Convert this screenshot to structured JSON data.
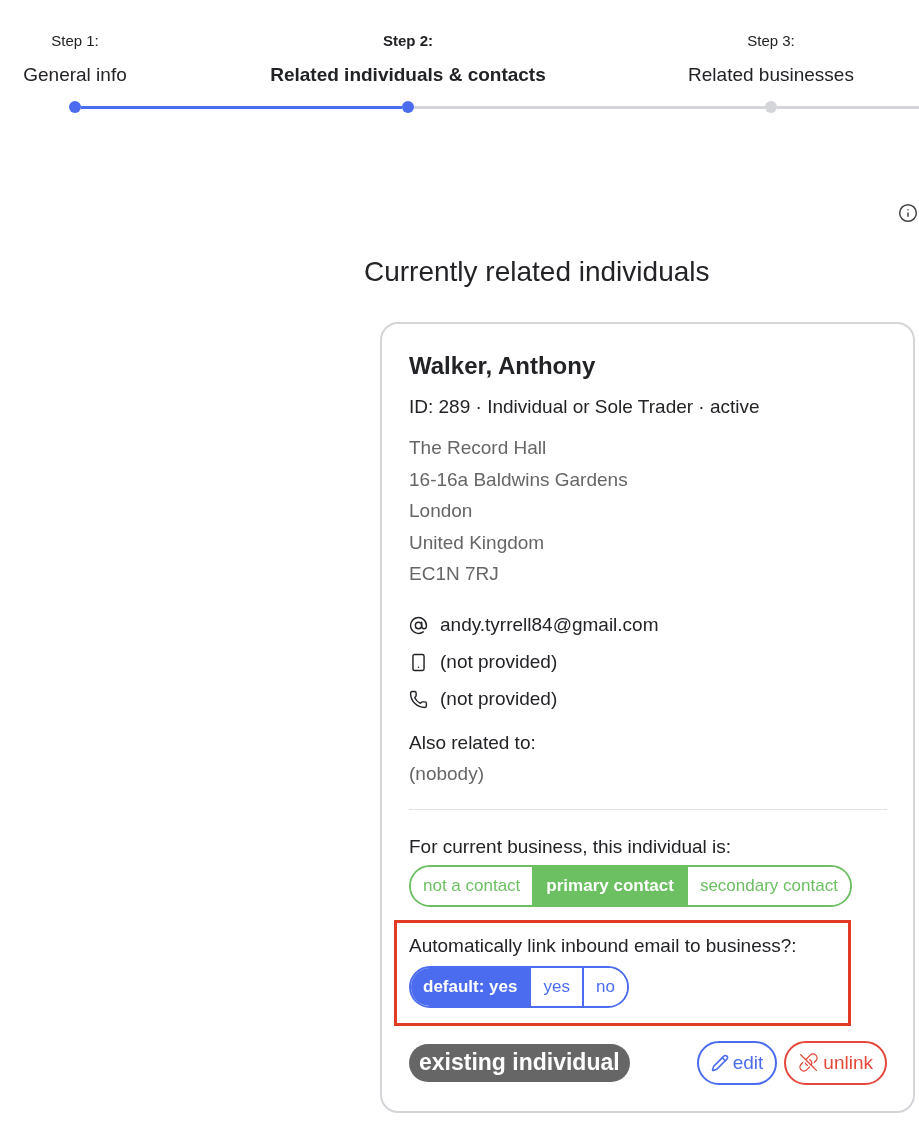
{
  "steps": [
    {
      "step": "Step 1:",
      "label": "General info",
      "completed": true,
      "current": false
    },
    {
      "step": "Step 2:",
      "label": "Related individuals & contacts",
      "completed": false,
      "current": true
    },
    {
      "step": "Step 3:",
      "label": "Related businesses",
      "completed": false,
      "current": false
    }
  ],
  "section_title": "Currently related individuals",
  "individual_card": {
    "name": "Walker, Anthony",
    "summary": "ID: 289 · Individual or Sole Trader · active",
    "address": [
      "The Record Hall",
      "16-16a Baldwins Gardens",
      "London",
      "United Kingdom",
      "EC1N 7RJ"
    ],
    "contacts": [
      {
        "kind": "email",
        "value": "andy.tyrrell84@gmail.com"
      },
      {
        "kind": "mobile",
        "value": "(not provided)"
      },
      {
        "kind": "phone",
        "value": "(not provided)"
      }
    ],
    "also_related_label": "Also related to:",
    "also_related_value": "(nobody)",
    "contact_role": {
      "label": "For current business, this individual is:",
      "options": [
        {
          "label": "not a contact",
          "selected": false
        },
        {
          "label": "primary contact",
          "selected": true
        },
        {
          "label": "secondary contact",
          "selected": false
        }
      ]
    },
    "email_link": {
      "label": "Automatically link inbound email to business?:",
      "highlighted": true,
      "options": [
        {
          "label": "default: yes",
          "selected": true
        },
        {
          "label": "yes",
          "selected": false
        },
        {
          "label": "no",
          "selected": false
        }
      ]
    },
    "badge": "existing individual",
    "actions": [
      {
        "kind": "edit",
        "label": "edit"
      },
      {
        "kind": "unlink",
        "label": "unlink"
      }
    ]
  }
}
